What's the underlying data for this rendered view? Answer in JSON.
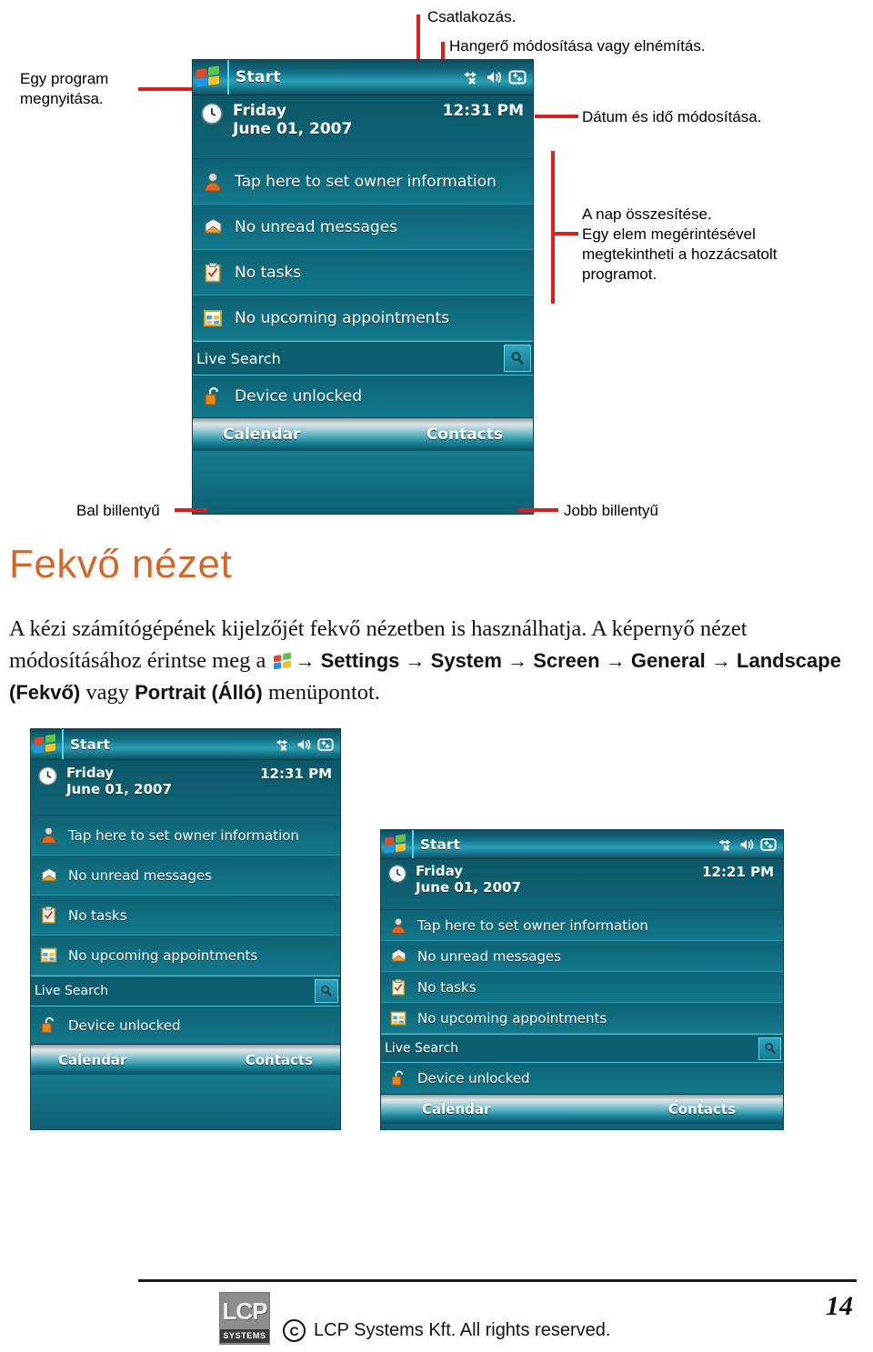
{
  "annotations": {
    "open_program": "Egy program\nmegnyitása.",
    "connection": "Csatlakozás.",
    "volume": "Hangerő módosítása vagy elnémítás.",
    "datetime": "Dátum és idő módosítása.",
    "day_summary": "A  nap összesítése.\nEgy elem megérintésével\nmegtekintheti a hozzácsatolt\nprogramot.",
    "left_key": "Bal billentyű",
    "right_key": "Jobb billentyű"
  },
  "section": {
    "heading": "Fekvő nézet",
    "paragraph": {
      "part1": "A kézi számítógépének kijelzőjét fekvő nézetben is használhatja.  A képernyő nézet módosításához érintse meg a",
      "arrow": "→",
      "settings": "Settings",
      "system": "System",
      "screen": "Screen",
      "general": "General",
      "landscape": "Landscape (Fekvő)",
      "or": "vagy",
      "portrait": "Portrait (Álló)",
      "tail": "menüpontot."
    }
  },
  "today_screen": {
    "start_label": "Start",
    "day": "Friday",
    "date": "June 01, 2007",
    "time_main": "12:31 PM",
    "time_landscape": "12:21 PM",
    "rows": [
      {
        "icon": "owner-icon",
        "text": "Tap here to set owner information"
      },
      {
        "icon": "mail-icon",
        "text": "No unread messages"
      },
      {
        "icon": "tasks-icon",
        "text": "No tasks"
      },
      {
        "icon": "calendar-icon",
        "text": "No upcoming appointments"
      }
    ],
    "search_placeholder": "Live Search",
    "locked_icon": "padlock-open-icon",
    "locked_text": "Device unlocked",
    "softkey_left": "Calendar",
    "softkey_right": "Contacts",
    "tray_icons": [
      "connectivity-icon",
      "volume-icon",
      "sync-icon"
    ]
  },
  "footer": {
    "logo_text": "LCP",
    "logo_sub": "SYSTEMS",
    "copyright_symbol": "C",
    "copyright_text": "LCP Systems Kft. All rights reserved.",
    "page_number": "14"
  },
  "colors": {
    "heading": "#D2692C",
    "annotation_rule": "#D92020",
    "screen_teal": "#12788c"
  }
}
